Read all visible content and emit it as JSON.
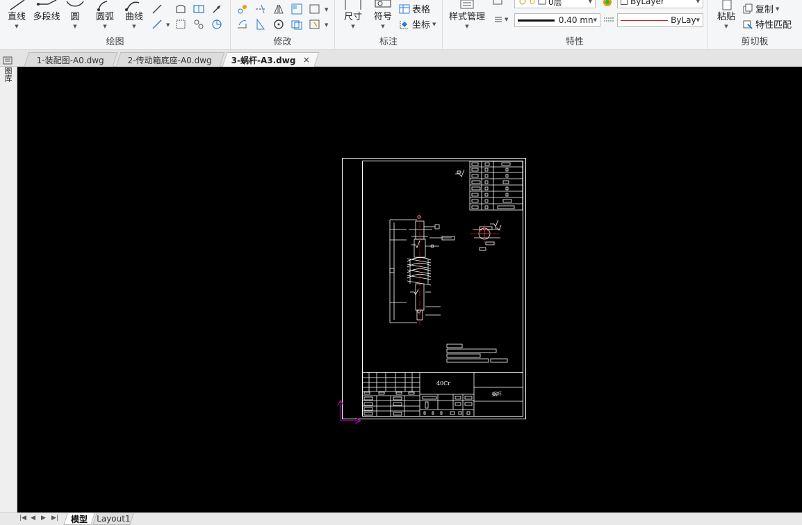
{
  "ribbon": {
    "draw": {
      "title": "绘图",
      "line": "直线",
      "polyline": "多段线",
      "circle": "圆",
      "arc": "圆弧",
      "curve": "曲线"
    },
    "modify": {
      "title": "修改"
    },
    "annotate": {
      "title": "标注",
      "dimension": "尺寸",
      "symbol": "符号",
      "table": "表格",
      "coordinate": "坐标"
    },
    "style_manager": "样式管理",
    "properties": {
      "title": "特性",
      "layer_value": "0层",
      "color_value": "ByLayer",
      "lineweight_value": "0.40 mn",
      "linetype_value": "ByLay"
    },
    "clipboard": {
      "title": "剪切板",
      "paste": "粘贴",
      "copy": "复制",
      "match_properties": "特性匹配"
    }
  },
  "tabs": [
    {
      "label": "1-装配图-A0.dwg",
      "active": false
    },
    {
      "label": "2-传动箱底座-A0.dwg",
      "active": false
    },
    {
      "label": "3-蜗杆-A3.dwg",
      "active": true
    }
  ],
  "tab_close": "×",
  "left_panel_label": "图库",
  "drawing": {
    "material": "40Cr",
    "part_name": "蜗杆"
  },
  "layout_tabs": [
    {
      "label": "模型",
      "active": true
    },
    {
      "label": "Layout1",
      "active": false
    }
  ],
  "colors": {
    "canvas": "#000000",
    "ucs": "#c000c0",
    "centerline": "#d01010",
    "linetype_red": "#d02020"
  }
}
